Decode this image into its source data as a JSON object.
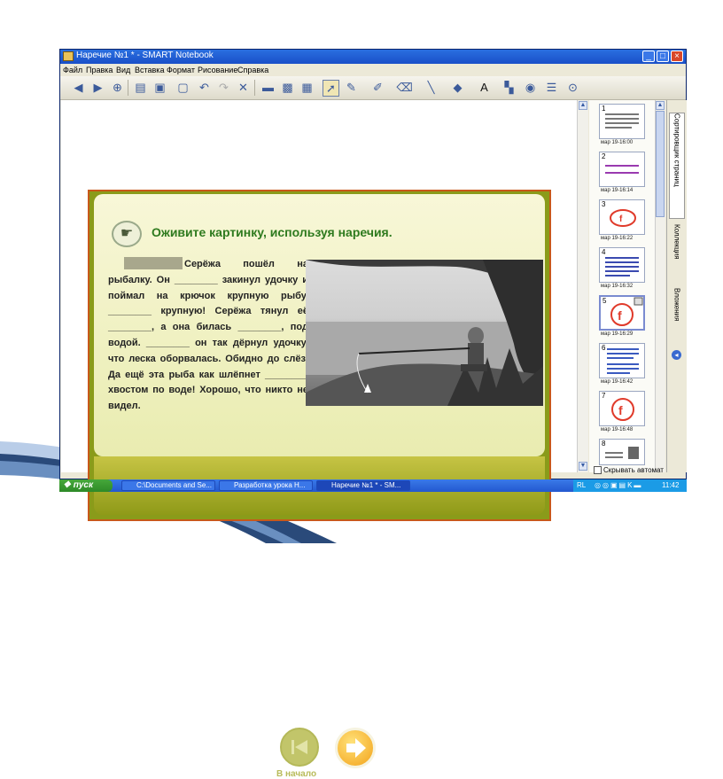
{
  "window": {
    "title": "Наречие №1 * - SMART Notebook",
    "controls": {
      "minimize": "_",
      "maximize": "□",
      "close": "×"
    }
  },
  "menu": [
    "Файл",
    "Правка",
    "Вид",
    "Вставка",
    "Формат",
    "Рисование",
    "Справка"
  ],
  "slide": {
    "heading": "Оживите картинку, используя наречия.",
    "story": "Серёжа пошёл на рыбалку. Он ________ закинул удочку и поймал на крючок крупную рыбу. ________ крупную! Серёжа тянул её ________, а она билась ________, под водой. ________ он так дёрнул удочку, что леска оборвалась. Обидно до слёз. Да ещё эта рыба как шлёпнет ________ хвостом по воде! Хорошо, что никто не видел.",
    "nav": {
      "start_label": "В начало",
      "next_label": "Вперед"
    }
  },
  "sorter": {
    "pages": [
      {
        "num": "1",
        "date": "мар 19-16:00"
      },
      {
        "num": "2",
        "date": "мар 19-16:14"
      },
      {
        "num": "3",
        "date": "мар 19-16:22"
      },
      {
        "num": "4",
        "date": "мар 19-16:32"
      },
      {
        "num": "5",
        "date": "мар 19-16:29"
      },
      {
        "num": "6",
        "date": "мар 19-16:42"
      },
      {
        "num": "7",
        "date": "мар 19-16:48"
      },
      {
        "num": "8",
        "date": ""
      }
    ],
    "autohide_label": "Скрывать автомат"
  },
  "tabs": [
    "Сортировщик страниц",
    "Коллекция",
    "Вложения"
  ],
  "taskbar": {
    "start_label": "пуск",
    "tasks": [
      "C:\\Documents and Se...",
      "Разработка урока Н...",
      "Наречие №1 * - SM..."
    ],
    "lang": "RL",
    "clock": "11:42"
  },
  "colors": {
    "titlebar": "#1a4fc8",
    "slide_border": "#c8581a",
    "slide_frame": "#8a9b1a",
    "heading": "#2e7a1e",
    "next_button": "#f3a21a"
  }
}
